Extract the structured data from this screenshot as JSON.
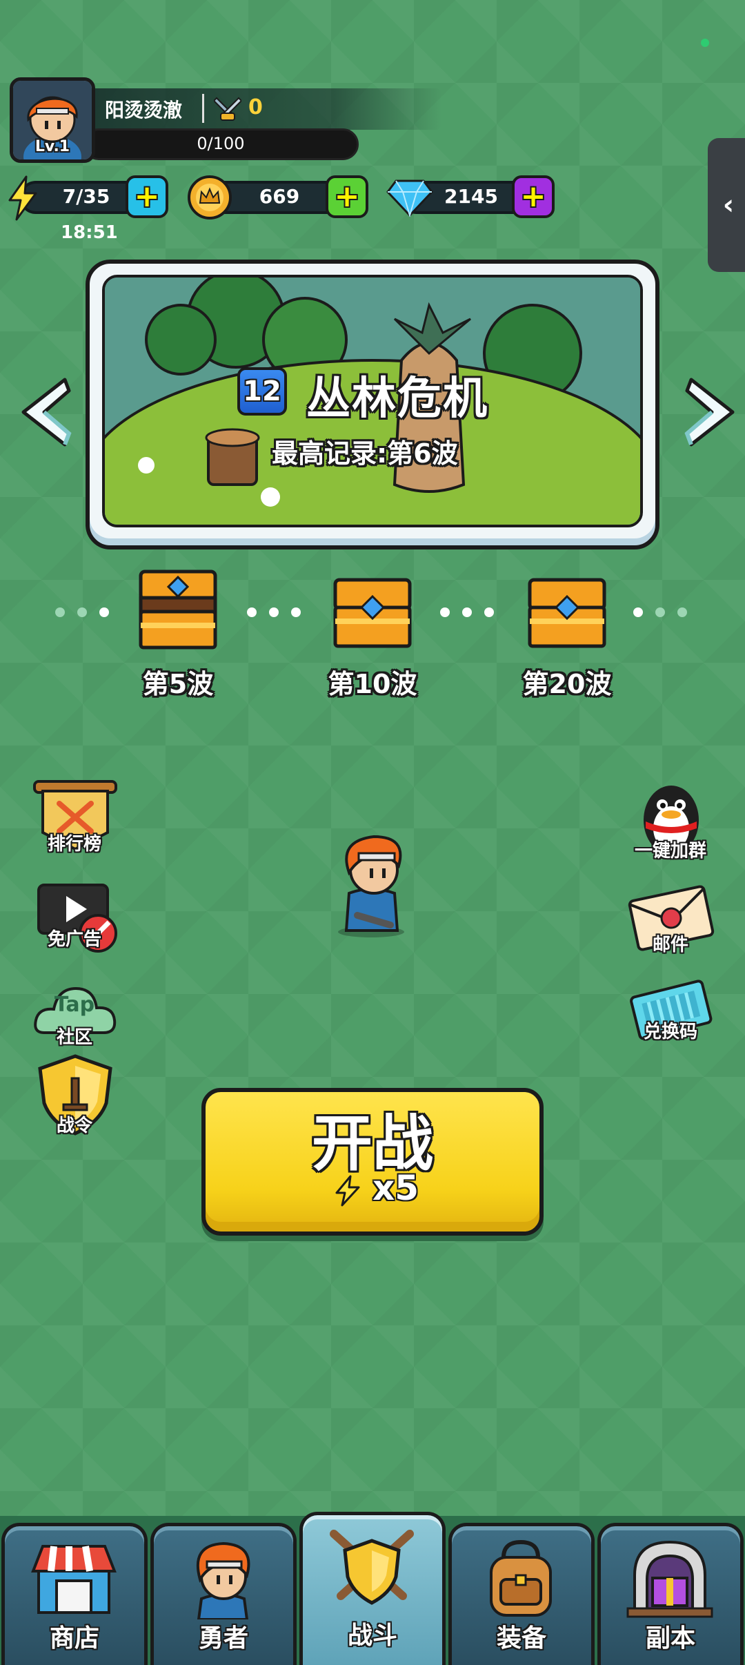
{
  "player": {
    "name": "阳烫烫澈",
    "level_label": "Lv.1",
    "trophies": "0",
    "exp": "0/100"
  },
  "resources": {
    "energy": "7/35",
    "energy_timer": "18:51",
    "gold": "669",
    "gems": "2145"
  },
  "stage": {
    "number": "12",
    "title": "丛林危机",
    "record": "最高记录:第6波"
  },
  "rewards": [
    {
      "label": "第5波"
    },
    {
      "label": "第10波"
    },
    {
      "label": "第20波"
    }
  ],
  "left_menu": {
    "leaderboard": "排行榜",
    "no_ads": "免广告",
    "community": "社区",
    "community_logo": "Tap",
    "battle_pass": "战令"
  },
  "right_menu": {
    "join_group": "一键加群",
    "mail": "邮件",
    "redeem": "兑换码"
  },
  "battle": {
    "label": "开战",
    "cost": "x5"
  },
  "nav": {
    "shop": "商店",
    "hero": "勇者",
    "battle": "战斗",
    "equipment": "装备",
    "dungeon": "副本"
  },
  "colors": {
    "background": "#4f9e68",
    "accent_yellow": "#f7d21a",
    "trophy_yellow": "#ffd33a",
    "plus_cyan": "#27c0e8",
    "plus_green": "#5bd135",
    "plus_purple": "#a12fe0"
  }
}
